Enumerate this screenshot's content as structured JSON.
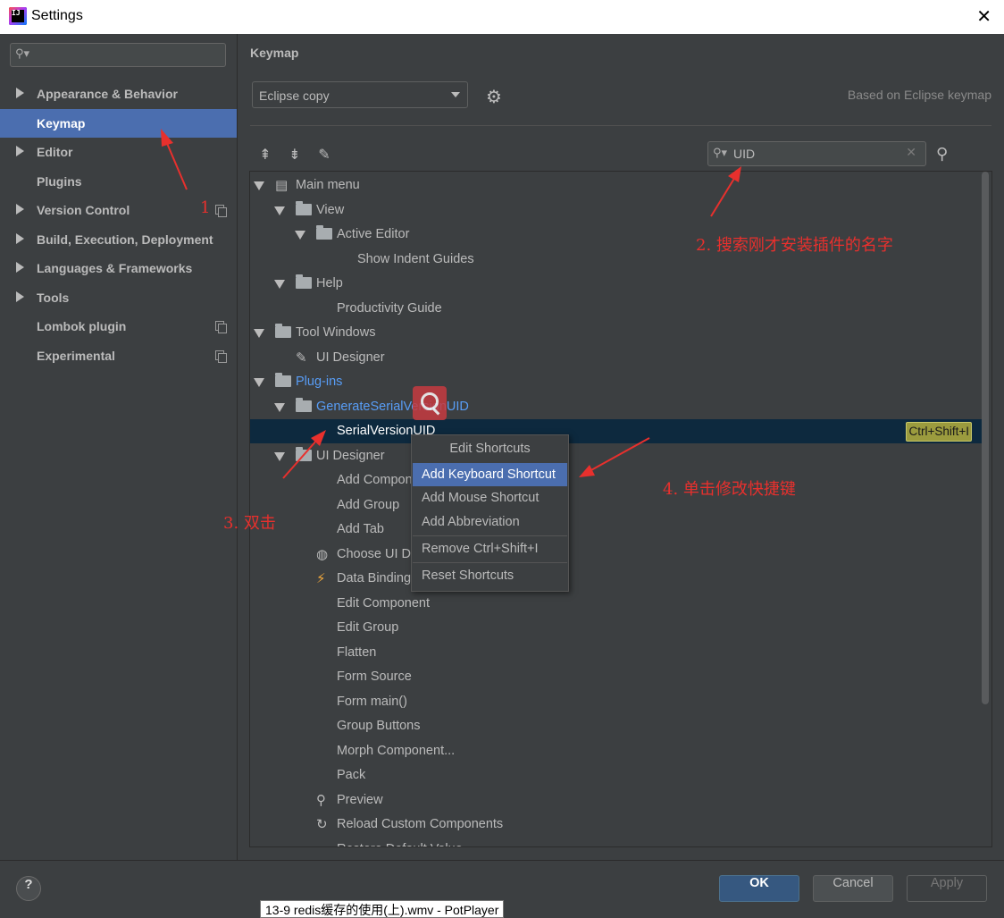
{
  "window": {
    "title": "Settings",
    "app_icon_text": "IJ",
    "close_glyph": "✕"
  },
  "sidebar": {
    "search_placeholder": "",
    "items": [
      {
        "label": "Appearance & Behavior",
        "expandable": true,
        "selected": false,
        "copy_icon": false
      },
      {
        "label": "Keymap",
        "expandable": false,
        "selected": true,
        "copy_icon": false
      },
      {
        "label": "Editor",
        "expandable": true,
        "selected": false,
        "copy_icon": false
      },
      {
        "label": "Plugins",
        "expandable": false,
        "selected": false,
        "copy_icon": false
      },
      {
        "label": "Version Control",
        "expandable": true,
        "selected": false,
        "copy_icon": true
      },
      {
        "label": "Build, Execution, Deployment",
        "expandable": true,
        "selected": false,
        "copy_icon": false
      },
      {
        "label": "Languages & Frameworks",
        "expandable": true,
        "selected": false,
        "copy_icon": false
      },
      {
        "label": "Tools",
        "expandable": true,
        "selected": false,
        "copy_icon": false
      },
      {
        "label": "Lombok plugin",
        "expandable": false,
        "selected": false,
        "copy_icon": true
      },
      {
        "label": "Experimental",
        "expandable": false,
        "selected": false,
        "copy_icon": true
      }
    ]
  },
  "main": {
    "section_title": "Keymap",
    "keymap_combo_value": "Eclipse copy",
    "based_on": "Based on Eclipse keymap",
    "filter_value": "UID",
    "toolbar_icons": [
      "expand-all-icon",
      "collapse-all-icon",
      "edit-icon"
    ],
    "tree": [
      {
        "label": "Main menu",
        "level": 0,
        "expanded": true,
        "icon": "menu-icon"
      },
      {
        "label": "View",
        "level": 1,
        "expanded": true,
        "icon": "folder-icon"
      },
      {
        "label": "Active Editor",
        "level": 2,
        "expanded": true,
        "icon": "folder-icon"
      },
      {
        "label": "Show Indent Guides",
        "level": 3,
        "icon": "none"
      },
      {
        "label": "Help",
        "level": 1,
        "expanded": true,
        "icon": "folder-icon"
      },
      {
        "label": "Productivity Guide",
        "level": 2,
        "icon": "none"
      },
      {
        "label": "Tool Windows",
        "level": 0,
        "expanded": true,
        "icon": "folder-icon"
      },
      {
        "label": "UI Designer",
        "level": 1,
        "icon": "edit-form-icon"
      },
      {
        "label": "Plug-ins",
        "level": 0,
        "expanded": true,
        "icon": "folder-icon",
        "link": true
      },
      {
        "label": "GenerateSerialVersionUID",
        "level": 1,
        "expanded": true,
        "icon": "folder-icon",
        "link": true
      },
      {
        "label": "SerialVersionUID",
        "level": 2,
        "icon": "none",
        "selected": true,
        "shortcut": "Ctrl+Shift+I"
      },
      {
        "label": "UI Designer",
        "level": 1,
        "expanded": true,
        "icon": "folder-icon"
      },
      {
        "label": "Add Component",
        "level": 2,
        "icon": "none"
      },
      {
        "label": "Add Group",
        "level": 2,
        "icon": "none"
      },
      {
        "label": "Add Tab",
        "level": 2,
        "icon": "none"
      },
      {
        "label": "Choose UI Designer Locale",
        "level": 2,
        "icon": "globe-icon"
      },
      {
        "label": "Data Binding Wizard",
        "level": 2,
        "icon": "lightning-icon"
      },
      {
        "label": "Edit Component",
        "level": 2,
        "icon": "none"
      },
      {
        "label": "Edit Group",
        "level": 2,
        "icon": "none"
      },
      {
        "label": "Flatten",
        "level": 2,
        "icon": "none"
      },
      {
        "label": "Form Source",
        "level": 2,
        "icon": "none"
      },
      {
        "label": "Form main()",
        "level": 2,
        "icon": "none"
      },
      {
        "label": "Group Buttons",
        "level": 2,
        "icon": "none"
      },
      {
        "label": "Morph Component...",
        "level": 2,
        "icon": "none"
      },
      {
        "label": "Pack",
        "level": 2,
        "icon": "none"
      },
      {
        "label": "Preview",
        "level": 2,
        "icon": "preview-icon"
      },
      {
        "label": "Reload Custom Components",
        "level": 2,
        "icon": "reload-icon"
      },
      {
        "label": "Restore Default Value",
        "level": 2,
        "icon": "none"
      }
    ]
  },
  "context_menu": {
    "header": "Edit Shortcuts",
    "items": [
      {
        "label": "Add Keyboard Shortcut",
        "selected": true
      },
      {
        "label": "Add Mouse Shortcut"
      },
      {
        "label": "Add Abbreviation"
      },
      {
        "label": "Remove Ctrl+Shift+I"
      },
      {
        "label": "Reset Shortcuts"
      }
    ]
  },
  "annotations": {
    "a1": "1",
    "a2": "2.  搜索刚才安装插件的名字",
    "a3": "3.  双击",
    "a4": "4.  单击修改快捷键",
    "color": "#e8302d"
  },
  "buttons": {
    "help": "?",
    "ok": "OK",
    "cancel": "Cancel",
    "apply": "Apply"
  },
  "taskbar_tooltip": "13-9 redis缓存的使用(上).wmv - PotPlayer",
  "colors": {
    "selection": "#4b6eaf",
    "tree_selection": "#0d293e",
    "link": "#589df6",
    "shortcut_bg": "#9b9b3e"
  }
}
